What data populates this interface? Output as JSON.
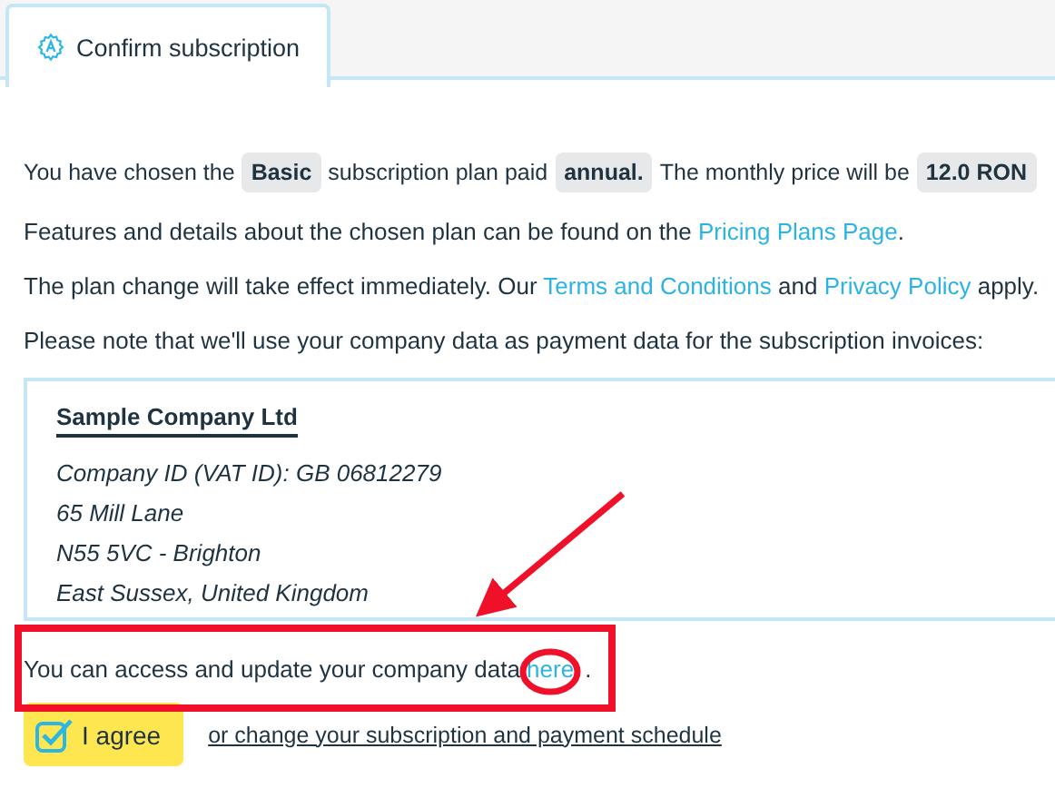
{
  "tabs": [
    {
      "label": "Confirm subscription",
      "selected": true
    }
  ],
  "summary": [
    {
      "kind": "text",
      "text": "You have chosen the"
    },
    {
      "kind": "tag",
      "text": "Basic"
    },
    {
      "kind": "text",
      "text": "subscription plan paid"
    },
    {
      "kind": "tag",
      "text": "annual."
    },
    {
      "kind": "text",
      "text": "The monthly price will be"
    },
    {
      "kind": "tag",
      "text": "12.0 RON"
    }
  ],
  "paragraphs": [
    [
      {
        "kind": "text",
        "text": "Features and details about the chosen plan can be found on the "
      },
      {
        "kind": "link",
        "text": "Pricing Plans Page"
      },
      {
        "kind": "text",
        "text": "."
      }
    ],
    [
      {
        "kind": "text",
        "text": "The plan change will take effect immediately. Our "
      },
      {
        "kind": "link",
        "text": "Terms and Conditions"
      },
      {
        "kind": "text",
        "text": " and "
      },
      {
        "kind": "link",
        "text": "Privacy Policy"
      },
      {
        "kind": "text",
        "text": " apply."
      }
    ],
    [
      {
        "kind": "text",
        "text": "Please note that we'll use your company data as payment data for the subscription invoices:"
      }
    ]
  ],
  "company": {
    "name": "Sample Company Ltd",
    "lines": [
      "Company ID (VAT ID): GB 06812279",
      "65 Mill Lane",
      "N55 5VC - Brighton",
      "East Sussex, United Kingdom"
    ]
  },
  "access_note": [
    {
      "kind": "text",
      "text": "You can access and update your company data "
    },
    {
      "kind": "link",
      "text": "here"
    },
    {
      "kind": "text",
      "text": "."
    }
  ],
  "agree_button": "I agree",
  "change_link": "or change your subscription and payment schedule"
}
